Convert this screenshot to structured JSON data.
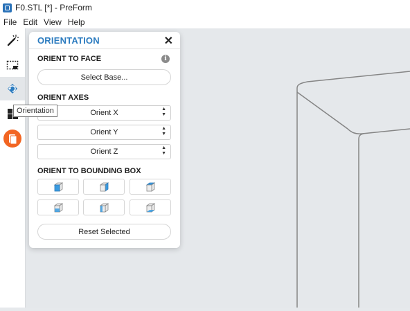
{
  "window": {
    "title": "F0.STL [*] - PreForm"
  },
  "menu": {
    "items": [
      "File",
      "Edit",
      "View",
      "Help"
    ]
  },
  "tooltip": {
    "text": "Orientation"
  },
  "panel": {
    "title": "ORIENTATION",
    "close": "✕",
    "orient_to_face": {
      "label": "ORIENT TO FACE",
      "button": "Select Base..."
    },
    "info_icon": "i",
    "orient_axes": {
      "label": "ORIENT AXES",
      "x": "Orient X",
      "y": "Orient Y",
      "z": "Orient Z"
    },
    "bounding_box": {
      "label": "ORIENT TO BOUNDING BOX"
    },
    "reset": "Reset Selected"
  },
  "colors": {
    "accent": "#2b7bbf",
    "orange": "#f26522",
    "cube_face": "#3a9be0"
  }
}
